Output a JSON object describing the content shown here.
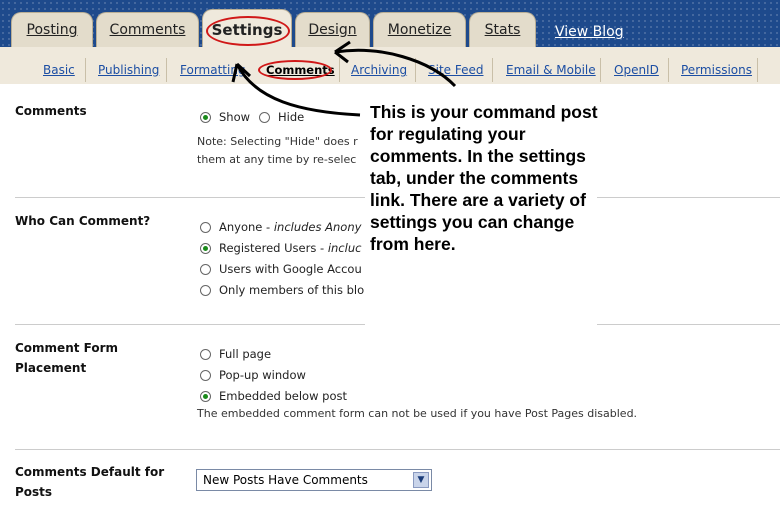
{
  "tabs": [
    {
      "label": "Posting"
    },
    {
      "label": "Comments"
    },
    {
      "label": "Settings"
    },
    {
      "label": "Design"
    },
    {
      "label": "Monetize"
    },
    {
      "label": "Stats"
    }
  ],
  "view_blog": "View Blog",
  "subnav": [
    {
      "label": "Basic"
    },
    {
      "label": "Publishing"
    },
    {
      "label": "Formatting"
    },
    {
      "label": "Comments"
    },
    {
      "label": "Archiving"
    },
    {
      "label": "Site Feed"
    },
    {
      "label": "Email & Mobile"
    },
    {
      "label": "OpenID"
    },
    {
      "label": "Permissions"
    }
  ],
  "sections": {
    "comments": {
      "label": "Comments",
      "options": [
        "Show",
        "Hide"
      ],
      "selected": "Show",
      "note_line1": "Note: Selecting \"Hide\" does r",
      "note_line2": "them at any time by re-selec"
    },
    "who_can_comment": {
      "label": "Who Can Comment?",
      "options": [
        {
          "text": "Anyone",
          "hint": "includes Anony"
        },
        {
          "text": "Registered Users",
          "hint": "incluc"
        },
        {
          "text": "Users with Google Accou",
          "hint": ""
        },
        {
          "text": "Only members of this blo",
          "hint": ""
        }
      ],
      "selected": "Registered Users"
    },
    "form_placement": {
      "label_line1": "Comment Form",
      "label_line2": "Placement",
      "options": [
        "Full page",
        "Pop-up window",
        "Embedded below post"
      ],
      "selected": "Embedded below post",
      "note": "The embedded comment form can not be used if you have Post Pages disabled."
    },
    "default": {
      "label_line1": "Comments Default for",
      "label_line2": "Posts",
      "value": "New Posts Have Comments"
    }
  },
  "callout": "This is your command post for regulating your comments.  In the settings tab, under the comments link.  There are a variety of settings you can change from here.",
  "colors": {
    "header_blue": "#1e4a8c",
    "tab_tan": "#e3dccb",
    "subnav_bg": "#efe9dc",
    "link_blue": "#1c4ea3",
    "annotation_red": "#d01818",
    "radio_green": "#1a8a1a"
  }
}
